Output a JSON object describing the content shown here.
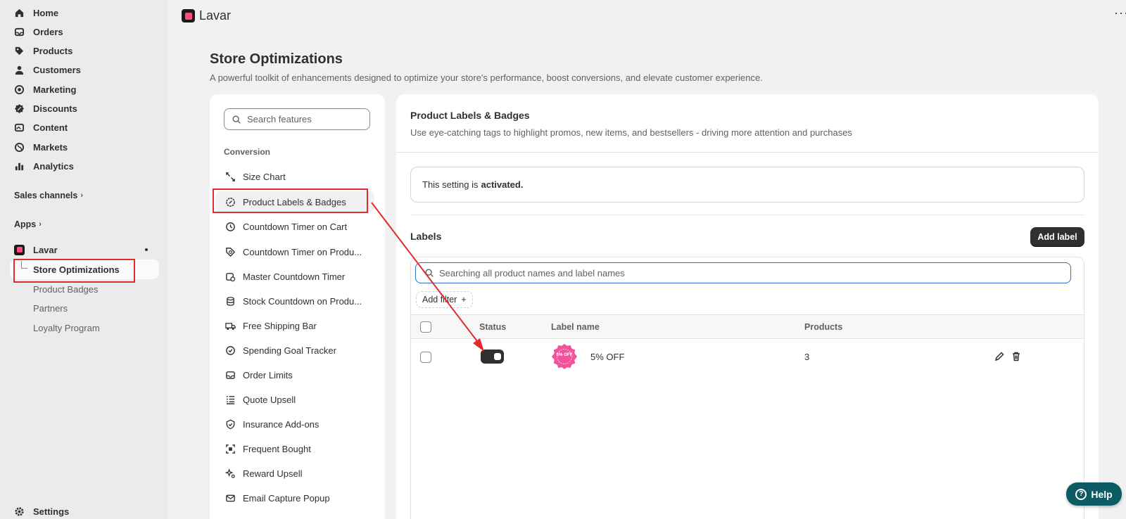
{
  "sidebar": {
    "nav": [
      {
        "label": "Home",
        "icon": "home-icon"
      },
      {
        "label": "Orders",
        "icon": "inbox-icon"
      },
      {
        "label": "Products",
        "icon": "tag-icon"
      },
      {
        "label": "Customers",
        "icon": "person-icon"
      },
      {
        "label": "Marketing",
        "icon": "target-icon"
      },
      {
        "label": "Discounts",
        "icon": "discount-icon"
      },
      {
        "label": "Content",
        "icon": "content-icon"
      },
      {
        "label": "Markets",
        "icon": "globe-icon"
      },
      {
        "label": "Analytics",
        "icon": "bar-chart-icon"
      }
    ],
    "sales_channels": "Sales channels",
    "apps": "Apps",
    "app_name": "Lavar",
    "app_items": [
      "Store Optimizations",
      "Product Badges",
      "Partners",
      "Loyalty Program"
    ],
    "settings": "Settings"
  },
  "topbar": {
    "title": "Lavar",
    "more": "···"
  },
  "page": {
    "title": "Store Optimizations",
    "subtitle": "A powerful toolkit of enhancements designed to optimize your store's performance, boost conversions, and elevate customer experience."
  },
  "features": {
    "search_placeholder": "Search features",
    "group": "Conversion",
    "items": [
      {
        "label": "Size Chart",
        "icon": "resize-icon"
      },
      {
        "label": "Product Labels & Badges",
        "icon": "badge-icon"
      },
      {
        "label": "Countdown Timer on Cart",
        "icon": "clock-icon"
      },
      {
        "label": "Countdown Timer on Produ...",
        "icon": "tag-clock-icon"
      },
      {
        "label": "Master Countdown Timer",
        "icon": "calendar-clock-icon"
      },
      {
        "label": "Stock Countdown on Produ...",
        "icon": "database-icon"
      },
      {
        "label": "Free Shipping Bar",
        "icon": "truck-icon"
      },
      {
        "label": "Spending Goal Tracker",
        "icon": "check-circle-icon"
      },
      {
        "label": "Order Limits",
        "icon": "inbox-icon"
      },
      {
        "label": "Quote Upsell",
        "icon": "list-icon"
      },
      {
        "label": "Insurance Add-ons",
        "icon": "shield-check-icon"
      },
      {
        "label": "Frequent Bought",
        "icon": "scan-icon"
      },
      {
        "label": "Reward Upsell",
        "icon": "sparkle-icon"
      },
      {
        "label": "Email Capture Popup",
        "icon": "mail-icon"
      }
    ]
  },
  "main": {
    "title": "Product Labels & Badges",
    "subtitle": "Use eye-catching tags to highlight promos, new items, and bestsellers - driving more attention and purchases",
    "banner_text": "This setting is",
    "banner_status": "activated.",
    "labels_title": "Labels",
    "add_label": "Add label",
    "search_placeholder": "Searching all product names and label names",
    "add_filter": "Add filter",
    "columns": {
      "status": "Status",
      "label_name": "Label name",
      "products": "Products"
    },
    "rows": [
      {
        "status": "on",
        "badge_text": "5% OFF",
        "label_name": "5% OFF",
        "products": "3"
      }
    ]
  },
  "help": {
    "label": "Help"
  },
  "colors": {
    "annotation": "#e22b2b",
    "help": "#0d5c63",
    "focus": "#2c6ecb",
    "badge": "#f0529c"
  }
}
